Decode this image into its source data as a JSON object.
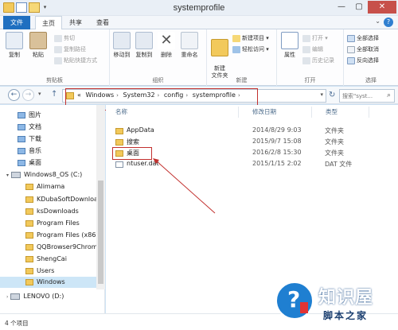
{
  "window": {
    "title": "systemprofile"
  },
  "tabs": {
    "file": "文件",
    "home": "主页",
    "share": "共享",
    "view": "查看"
  },
  "ribbon": {
    "clipboard": {
      "label": "剪贴板",
      "copy": "复制",
      "paste": "粘贴",
      "cut": "剪切",
      "copy_path": "复制路径",
      "paste_shortcut": "粘贴快捷方式"
    },
    "organize": {
      "label": "组织",
      "move_to": "移动到",
      "copy_to": "复制到",
      "delete": "删除",
      "rename": "重命名"
    },
    "new": {
      "label": "新建",
      "new_folder": "新建\n文件夹",
      "new_item": "新建项目",
      "easy_access": "轻松访问"
    },
    "open": {
      "label": "打开",
      "properties": "属性",
      "open": "打开",
      "edit": "编辑",
      "history": "历史记录"
    },
    "select": {
      "label": "选择",
      "select_all": "全部选择",
      "select_none": "全部取消",
      "invert": "反向选择"
    }
  },
  "address": {
    "crumbs": [
      "Windows",
      "System32",
      "config",
      "systemprofile"
    ],
    "prefix": "«",
    "search_placeholder": "搜索\"syst..."
  },
  "nav": {
    "items": [
      "图片",
      "文档",
      "下载",
      "音乐",
      "桌面",
      "Windows8_OS (C:)",
      "Alimama",
      "KDubaSoftDownloa",
      "ksDownloads",
      "Program Files",
      "Program Files (x86)",
      "QQBrowser9Chrom",
      "ShengCai",
      "Users",
      "Windows",
      "LENOVO (D:)"
    ]
  },
  "columns": {
    "name": "名称",
    "date": "修改日期",
    "type": "类型"
  },
  "files": [
    {
      "name": "AppData",
      "date": "2014/8/29 9:03",
      "type": "文件夹"
    },
    {
      "name": "搜索",
      "date": "2015/9/7 15:08",
      "type": "文件夹"
    },
    {
      "name": "桌面",
      "date": "2016/2/8 15:30",
      "type": "文件夹"
    },
    {
      "name": "ntuser.dat",
      "date": "2015/1/15 2:02",
      "type": "DAT 文件"
    }
  ],
  "status": {
    "count": "4 个项目"
  },
  "watermark": {
    "line1": "知识屋",
    "line2": "脚本之家"
  },
  "colors": {
    "accent": "#1f6fc0",
    "annotation": "#c2302e",
    "selection": "#cde6f7"
  }
}
